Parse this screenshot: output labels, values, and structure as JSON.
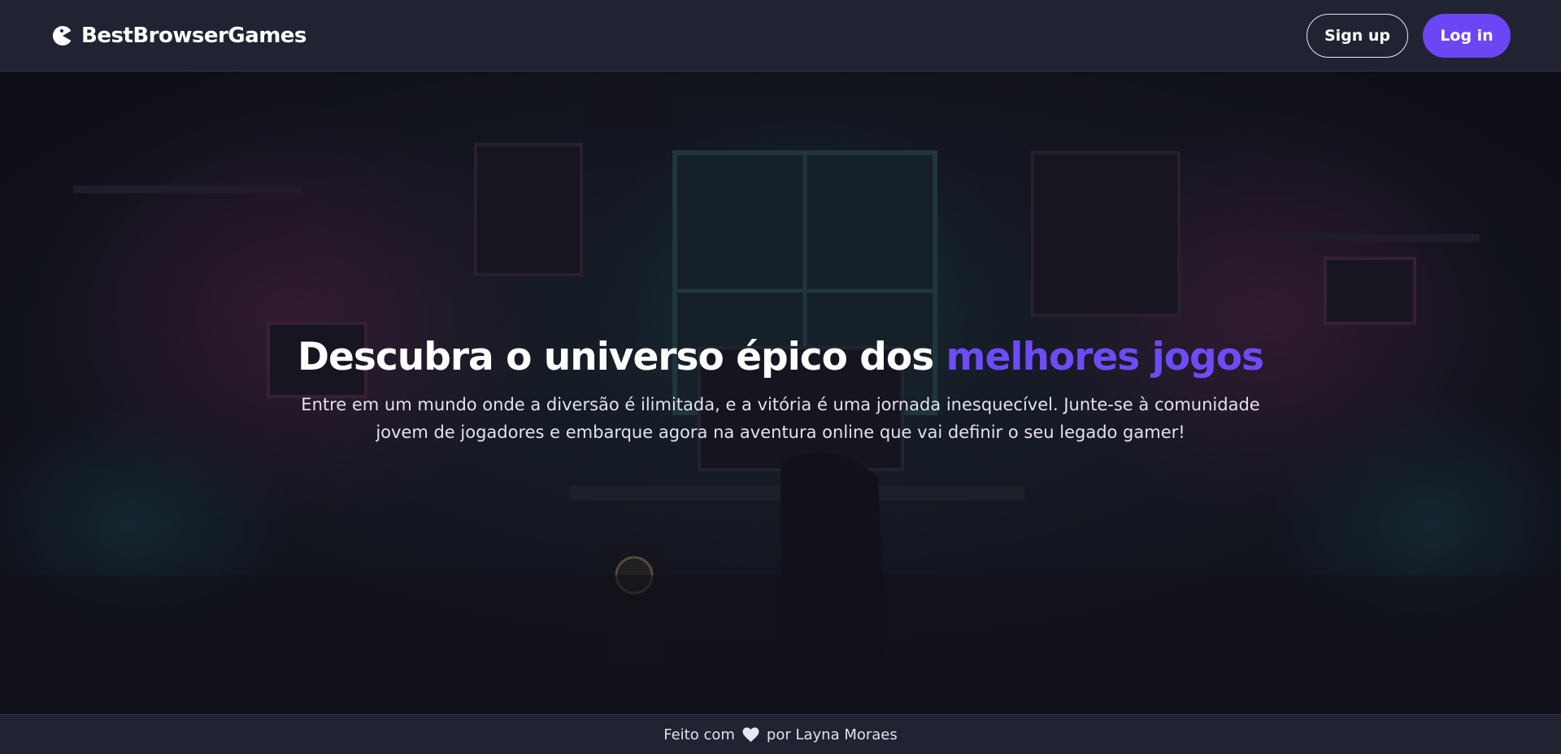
{
  "header": {
    "brand_name": "BestBrowserGames",
    "logo_icon": "pacman-icon",
    "signup_label": "Sign up",
    "login_label": "Log in"
  },
  "hero": {
    "title_main": "Descubra o universo épico dos ",
    "title_accent": "melhores jogos",
    "subtitle": "Entre em um mundo onde a diversão é ilimitada, e a vitória é uma jornada inesquecível. Junte-se à comunidade jovem de jogadores e embarque agora na aventura online que vai definir o seu legado gamer!",
    "background": "dark gaming room illustration"
  },
  "footer": {
    "prefix": "Feito com",
    "icon": "heart-icon",
    "suffix": "por Layna Moraes"
  },
  "colors": {
    "navbar_bg": "#212333",
    "accent": "#6b46f5",
    "hero_overlay": "#12111c",
    "text": "#ffffff"
  }
}
